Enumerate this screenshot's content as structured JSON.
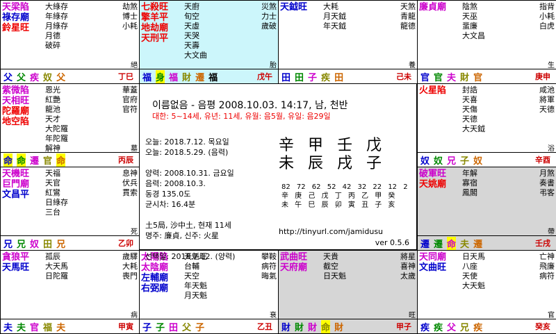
{
  "center": {
    "title": "이름없음 - 음평 2008.10.03. 14:17, 남, 천반",
    "subtitle": "대한: 5~14세, 유년: 11세, 유월: 음5월, 유일: 음29일",
    "info": [
      "오늘: 2018.7.12. 목요일",
      "오늘: 2018.5.29. (음력)",
      "",
      "양력: 2008.10.31. 금요일",
      "음력: 2008.10.3.",
      "동경 135.0도",
      "균시차: 16.4분",
      "",
      "土5局, 沙中土, 현재 11세",
      "명주: 廉貞, 신주: 火星",
      "",
      "선택일: 2018.7.12. (양력)"
    ],
    "pillars_top": "辛甲壬戊",
    "pillars_bottom": "未辰戌子",
    "ages": "82 72 62 52 42 32 22 12 2",
    "ages_stems": "辛 庚 己 戊 丁 丙 乙 甲 癸",
    "ages_branches": "未 午 巳 辰 卯 寅 丑 子 亥",
    "url": "http://tinyurl.com/jamidusu",
    "version": "ver 0.5.6"
  },
  "cells": [
    {
      "id": "si",
      "main": [
        {
          "t": "天梁陷",
          "c": "c-mag"
        },
        {
          "t": "祿存廟",
          "c": "c-blue"
        },
        {
          "t": "鈴星旺",
          "c": "c-red"
        }
      ],
      "minor": [
        {
          "t": "大綠存"
        },
        {
          "t": "年綠存"
        },
        {
          "t": "月綠存"
        },
        {
          "t": "月德"
        },
        {
          "t": "破碎"
        }
      ],
      "right": [
        {
          "t": "劫煞"
        },
        {
          "t": "博士"
        },
        {
          "t": "小耗"
        }
      ],
      "stage": "絕",
      "stem": "丁巳",
      "palaces": [
        "父",
        "父",
        "疾",
        "奴",
        "父"
      ]
    },
    {
      "id": "o",
      "main": [
        {
          "t": "七殺旺",
          "c": "c-red"
        },
        {
          "t": "擎羊平",
          "c": "c-red"
        },
        {
          "t": "地劫廟",
          "c": "c-red"
        },
        {
          "t": "天刑平",
          "c": "c-red"
        }
      ],
      "minor": [
        {
          "t": "天廚"
        },
        {
          "t": "旬空"
        },
        {
          "t": "天虛"
        },
        {
          "t": "天哭"
        },
        {
          "t": "天壽"
        },
        {
          "t": "大文曲"
        }
      ],
      "right": [
        {
          "t": "災煞"
        },
        {
          "t": "力士"
        },
        {
          "t": "歲破"
        }
      ],
      "stage": "胎",
      "stem": "戊午",
      "palaces": [
        "福",
        "身",
        "福",
        "財",
        "遷",
        "福"
      ]
    },
    {
      "id": "mi",
      "main": [
        {
          "t": "天鉞旺",
          "c": "c-blue"
        }
      ],
      "minor": [
        {
          "t": "大耗"
        },
        {
          "t": "月天鉞"
        },
        {
          "t": "年天鉞"
        }
      ],
      "right": [
        {
          "t": "天煞"
        },
        {
          "t": "青龍"
        },
        {
          "t": "龍德"
        }
      ],
      "stage": "養",
      "stem": "己未",
      "palaces": [
        "田",
        "田",
        "子",
        "疾",
        "田"
      ]
    },
    {
      "id": "shin",
      "main": [
        {
          "t": "廉貞廟",
          "c": "c-mag"
        }
      ],
      "minor": [
        {
          "t": "陰煞"
        },
        {
          "t": "天巫"
        },
        {
          "t": "蜚廉"
        },
        {
          "t": "大文昌"
        }
      ],
      "right": [
        {
          "t": "指背"
        },
        {
          "t": "小耗"
        },
        {
          "t": "白虎"
        }
      ],
      "stage": "生",
      "stem": "庚申",
      "palaces": [
        "官",
        "官",
        "夫",
        "財",
        "官"
      ]
    },
    {
      "id": "jin",
      "main": [
        {
          "t": "紫微陷",
          "c": "c-mag"
        },
        {
          "t": "天相旺",
          "c": "c-mag"
        },
        {
          "t": "陀羅廟",
          "c": "c-red"
        },
        {
          "t": "地空陷",
          "c": "c-red"
        }
      ],
      "minor": [
        {
          "t": "恩光"
        },
        {
          "t": "紅艷"
        },
        {
          "t": "龍池"
        },
        {
          "t": "天才"
        },
        {
          "t": "大陀羅"
        },
        {
          "t": "年陀羅"
        },
        {
          "t": "解神"
        }
      ],
      "right": [
        {
          "t": "華蓋"
        },
        {
          "t": "官府"
        },
        {
          "t": "官符"
        }
      ],
      "stage": "墓",
      "stem": "丙辰",
      "palaces": [
        "命",
        "命",
        "遷",
        "官",
        "命"
      ]
    },
    {
      "id": "yu",
      "main": [
        {
          "t": "火星陷",
          "c": "c-red"
        }
      ],
      "minor": [
        {
          "t": "封誥"
        },
        {
          "t": "天喜"
        },
        {
          "t": "天傷"
        },
        {
          "t": "天德"
        },
        {
          "t": "大天鉞"
        }
      ],
      "right": [
        {
          "t": "咸池"
        },
        {
          "t": "將軍"
        },
        {
          "t": "天德"
        }
      ],
      "stage": "浴",
      "stem": "辛酉",
      "palaces": [
        "奴",
        "奴",
        "兄",
        "子",
        "奴"
      ]
    },
    {
      "id": "myo",
      "main": [
        {
          "t": "天機旺",
          "c": "c-mag"
        },
        {
          "t": "巨門廟",
          "c": "c-mag"
        },
        {
          "t": "文昌平",
          "c": "c-blue"
        }
      ],
      "minor": [
        {
          "t": "天福"
        },
        {
          "t": "天官"
        },
        {
          "t": "紅鸞"
        },
        {
          "t": "日綠存"
        },
        {
          "t": "三台"
        }
      ],
      "right": [
        {
          "t": "息神"
        },
        {
          "t": "伏兵"
        },
        {
          "t": "貫索"
        }
      ],
      "stage": "死",
      "stem": "乙卯",
      "palaces": [
        "兄",
        "兄",
        "奴",
        "田",
        "兄"
      ]
    },
    {
      "id": "sul",
      "main": [
        {
          "t": "破軍旺",
          "c": "c-mag"
        },
        {
          "t": "天姚廟",
          "c": "c-red"
        }
      ],
      "minor": [
        {
          "t": "年解"
        },
        {
          "t": "寡宿"
        },
        {
          "t": "鳳閣"
        }
      ],
      "right": [
        {
          "t": "月煞"
        },
        {
          "t": "奏書"
        },
        {
          "t": "弔客"
        }
      ],
      "stage": "帶",
      "stem": "壬戌",
      "palaces": [
        "遷",
        "遷",
        "命",
        "夫",
        "遷"
      ]
    },
    {
      "id": "in",
      "main": [
        {
          "t": "貪狼平",
          "c": "c-mag"
        },
        {
          "t": "天馬旺",
          "c": "c-blue"
        }
      ],
      "minor": [
        {
          "t": "孤辰"
        },
        {
          "t": "大天馬"
        },
        {
          "t": "日陀羅"
        }
      ],
      "right": [
        {
          "t": "歲驛"
        },
        {
          "t": "大耗"
        },
        {
          "t": "喪門"
        }
      ],
      "stage": "病",
      "stem": "甲寅",
      "palaces": [
        "夫",
        "夫",
        "官",
        "福",
        "夫"
      ]
    },
    {
      "id": "chuk",
      "main": [
        {
          "t": "太陽陷",
          "c": "c-mag"
        },
        {
          "t": "太陰廟",
          "c": "c-mag"
        },
        {
          "t": "左輔廟",
          "c": "c-blue"
        },
        {
          "t": "右弼廟",
          "c": "c-blue"
        }
      ],
      "minor": [
        {
          "t": "天魁旺"
        },
        {
          "t": "台輔"
        },
        {
          "t": "天空"
        },
        {
          "t": "年天魁"
        },
        {
          "t": "月天魁"
        }
      ],
      "right": [
        {
          "t": "攀鞍"
        },
        {
          "t": "病符"
        },
        {
          "t": "晦氣"
        }
      ],
      "stage": "衰",
      "stem": "乙丑",
      "palaces": [
        "子",
        "子",
        "田",
        "父",
        "子"
      ]
    },
    {
      "id": "ja",
      "main": [
        {
          "t": "武曲旺",
          "c": "c-mag"
        },
        {
          "t": "天府廟",
          "c": "c-mag"
        }
      ],
      "minor": [
        {
          "t": "天貴"
        },
        {
          "t": "截空"
        },
        {
          "t": "日天魁"
        }
      ],
      "right": [
        {
          "t": "將星"
        },
        {
          "t": "喜神"
        },
        {
          "t": "太歲"
        }
      ],
      "stage": "旺",
      "stem": "甲子",
      "palaces": [
        "財",
        "財",
        "財",
        "命",
        "財"
      ]
    },
    {
      "id": "hae",
      "main": [
        {
          "t": "天同廟",
          "c": "c-mag"
        },
        {
          "t": "文曲旺",
          "c": "c-blue"
        }
      ],
      "minor": [
        {
          "t": "日天馬"
        },
        {
          "t": "八座"
        },
        {
          "t": "天使"
        },
        {
          "t": "大天魁"
        }
      ],
      "right": [
        {
          "t": "亡神"
        },
        {
          "t": "飛廉"
        },
        {
          "t": "病符"
        }
      ],
      "stage": "官",
      "stem": "癸亥",
      "palaces": [
        "疾",
        "疾",
        "父",
        "兄",
        "疾"
      ]
    }
  ]
}
